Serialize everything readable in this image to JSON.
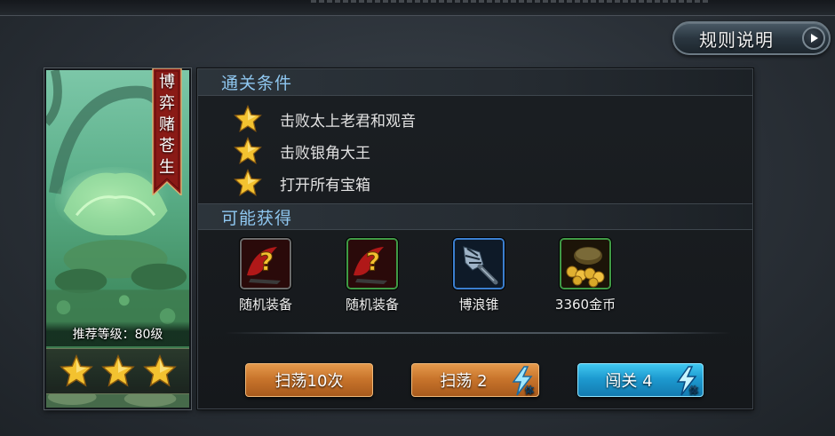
{
  "header": {
    "rules_label": "规则说明"
  },
  "stage": {
    "banner_title": "博弈赌苍生",
    "recommended_level": "推荐等级：80级",
    "stars_earned": 3,
    "stars_total": 3
  },
  "conditions": {
    "title": "通关条件",
    "items": [
      {
        "text": "击败太上老君和观音"
      },
      {
        "text": "击败银角大王"
      },
      {
        "text": "打开所有宝箱"
      }
    ]
  },
  "rewards": {
    "title": "可能获得",
    "items": [
      {
        "name": "随机装备",
        "icon": "random-equipment-icon",
        "frame": "gray"
      },
      {
        "name": "随机装备",
        "icon": "random-equipment-icon",
        "frame": "green"
      },
      {
        "name": "博浪锥",
        "icon": "mace-icon",
        "frame": "blue"
      },
      {
        "name": "3360金币",
        "icon": "gold-coins-icon",
        "frame": "green"
      }
    ]
  },
  "actions": {
    "sweep_10_label": "扫荡10次",
    "sweep_label": "扫荡 2",
    "challenge_label": "闯关 4",
    "stamina_label": "体"
  },
  "colors": {
    "section_title": "#8fc7f0",
    "orange_button": "#c9752c",
    "blue_button": "#1d9ad0",
    "star_gold": "#f3c230"
  }
}
